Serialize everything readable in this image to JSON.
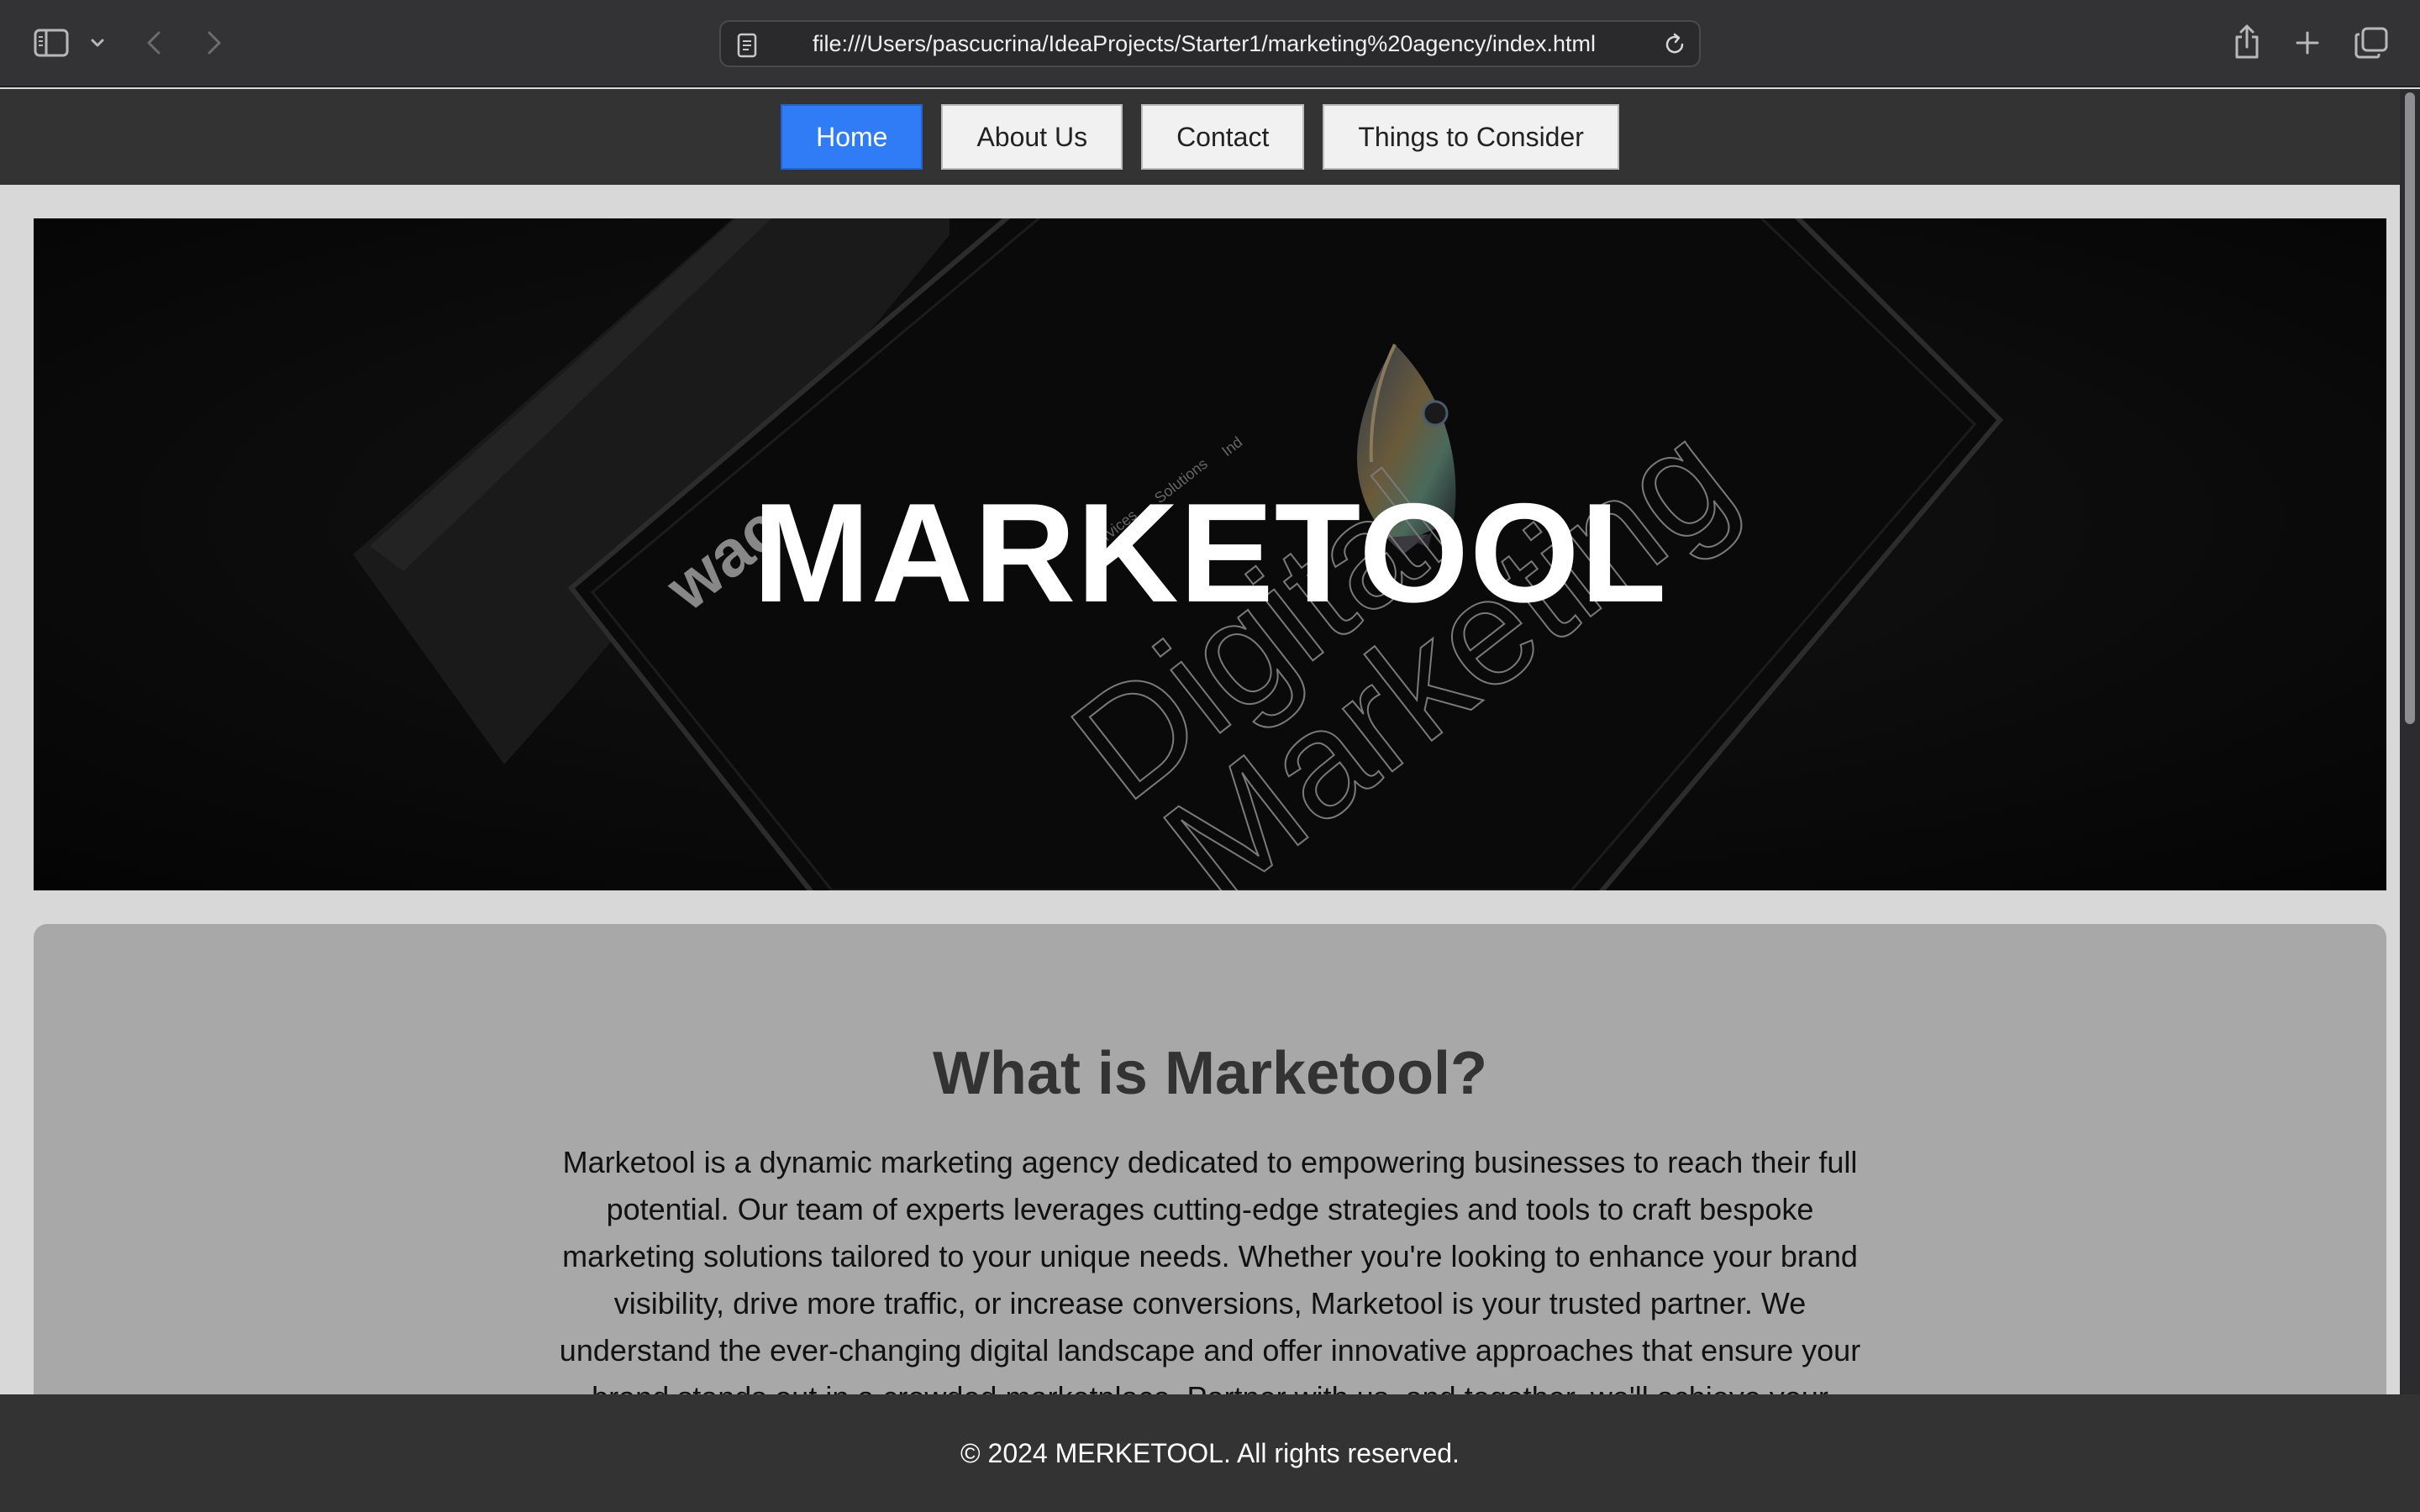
{
  "browser": {
    "url": "file:///Users/pascucrina/IdeaProjects/Starter1/marketing%20agency/index.html"
  },
  "nav": {
    "items": [
      {
        "label": "Home",
        "active": true
      },
      {
        "label": "About Us",
        "active": false
      },
      {
        "label": "Contact",
        "active": false
      },
      {
        "label": "Things to Consider",
        "active": false
      }
    ]
  },
  "hero": {
    "title": "MARKETOOL",
    "background_words": {
      "menu": [
        "Services",
        "Solutions",
        "Ind"
      ],
      "brand_fragment": "wac",
      "line1": "Digital",
      "line2": "Marketing"
    }
  },
  "about": {
    "title": "What is Marketool?",
    "text": "Marketool is a dynamic marketing agency dedicated to empowering businesses to reach their full potential. Our team of experts leverages cutting-edge strategies and tools to craft bespoke marketing solutions tailored to your unique needs. Whether you're looking to enhance your brand visibility, drive more traffic, or increase conversions, Marketool is your trusted partner. We understand the ever-changing digital landscape and offer innovative approaches that ensure your brand stands out in a crowded marketplace. Partner with us, and together, we'll achieve your business goals."
  },
  "footer": {
    "text": "© 2024 MERKETOOL. All rights reserved."
  },
  "colors": {
    "nav_active": "#2f7cf6",
    "nav_bg": "#333333",
    "page_bg": "#d8d8d8",
    "card_bg": "#a8a8a8"
  },
  "icons": [
    "sidebar-icon",
    "chevron-down-icon",
    "back-arrow-icon",
    "forward-arrow-icon",
    "page-icon",
    "reload-icon",
    "share-icon",
    "plus-icon",
    "tabs-overview-icon"
  ]
}
